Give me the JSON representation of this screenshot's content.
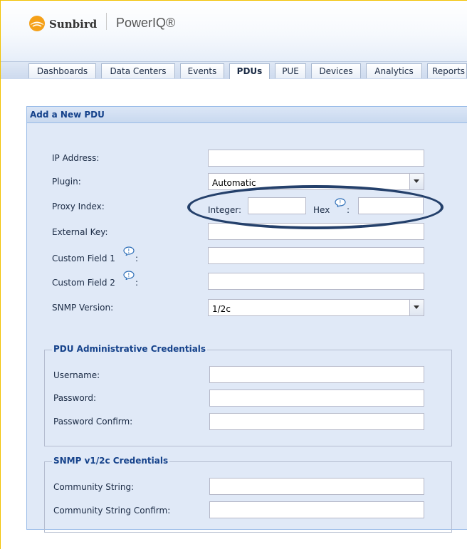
{
  "header": {
    "brand": "Sunbird",
    "product": "PowerIQ®",
    "logo_icon": "sunbird-logo-icon"
  },
  "tabs": [
    {
      "label": "Dashboards",
      "active": false
    },
    {
      "label": "Data Centers",
      "active": false
    },
    {
      "label": "Events",
      "active": false
    },
    {
      "label": "PDUs",
      "active": true
    },
    {
      "label": "PUE",
      "active": false
    },
    {
      "label": "Devices",
      "active": false
    },
    {
      "label": "Analytics",
      "active": false
    },
    {
      "label": "Reports",
      "active": false
    }
  ],
  "panel": {
    "title": "Add a New PDU",
    "fields": {
      "ip_address": {
        "label": "IP Address:",
        "value": ""
      },
      "plugin": {
        "label": "Plugin:",
        "value": "Automatic"
      },
      "proxy_index": {
        "label": "Proxy Index:",
        "integer_label": "Integer:",
        "integer_value": "",
        "hex_label": "Hex",
        "hex_colon": ":",
        "hex_value": ""
      },
      "external_key": {
        "label": "External Key:",
        "value": ""
      },
      "custom_field_1": {
        "label": "Custom Field 1",
        "colon": ":",
        "value": ""
      },
      "custom_field_2": {
        "label": "Custom Field 2",
        "colon": ":",
        "value": ""
      },
      "snmp_version": {
        "label": "SNMP Version:",
        "value": "1/2c"
      }
    },
    "admin_credentials": {
      "legend": "PDU Administrative Credentials",
      "username_label": "Username:",
      "username_value": "",
      "password_label": "Password:",
      "password_value": "",
      "password_confirm_label": "Password Confirm:",
      "password_confirm_value": ""
    },
    "snmp_credentials": {
      "legend": "SNMP v1/2c Credentials",
      "community_label": "Community String:",
      "community_value": "",
      "community_confirm_label": "Community String Confirm:",
      "community_confirm_value": ""
    }
  },
  "annotation": {
    "shape": "ellipse",
    "color": "#24406b",
    "highlights": "proxy-index"
  },
  "colors": {
    "panel_bg": "#e0e9f7",
    "panel_border": "#99bbe8",
    "title_text": "#15428b",
    "brand_orange": "#f5a11a",
    "frame_yellow": "#f2c200"
  }
}
